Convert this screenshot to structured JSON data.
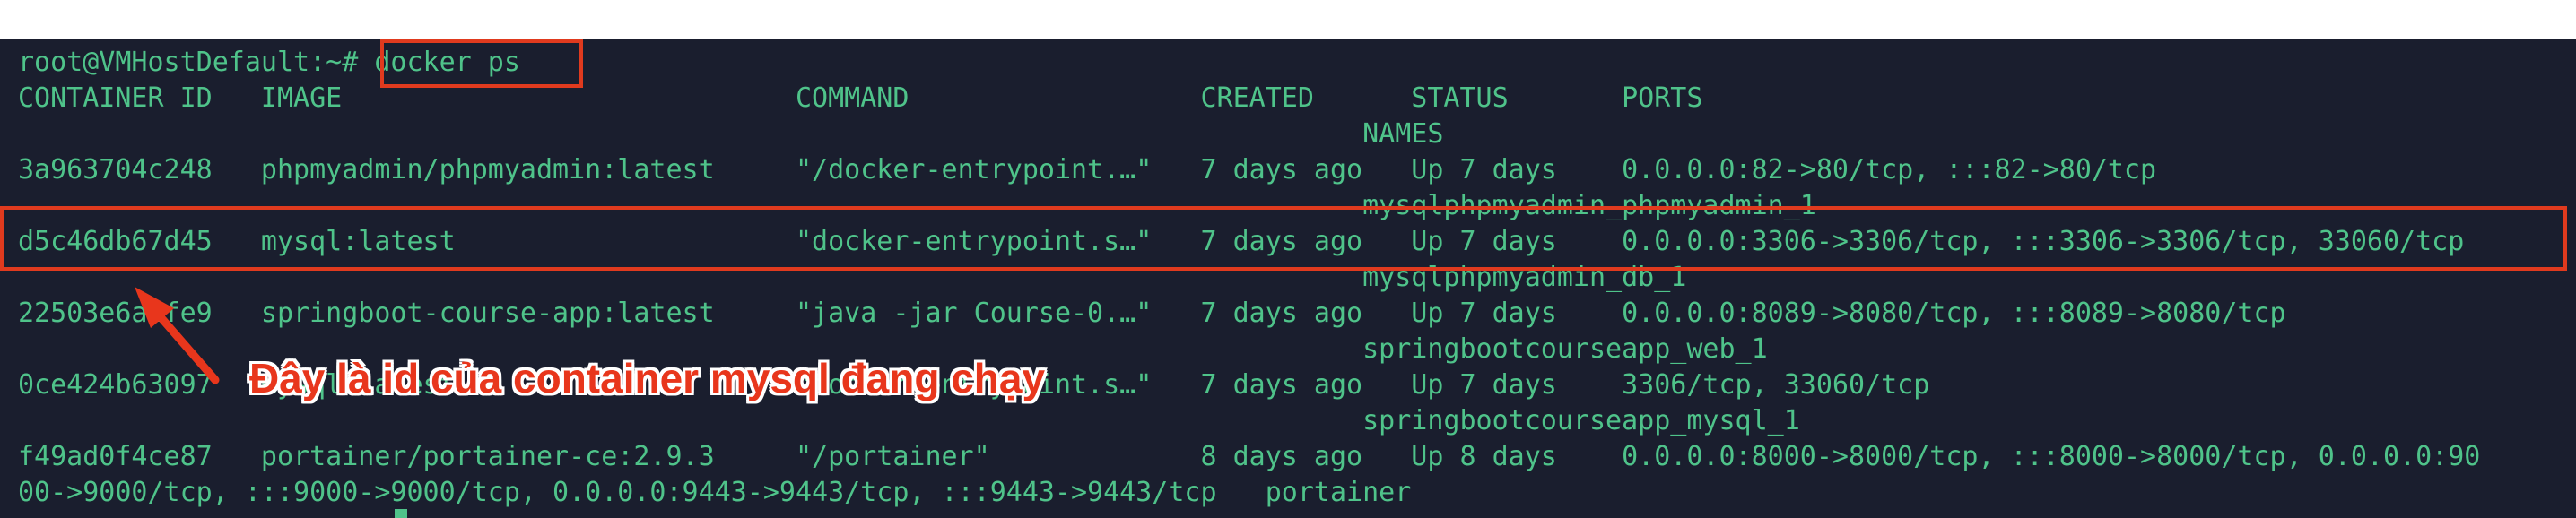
{
  "terminal": {
    "lines": [
      "root@VMHostDefault:~# docker ps",
      "CONTAINER ID   IMAGE                            COMMAND                  CREATED      STATUS       PORTS",
      "                                                                                   NAMES",
      "3a963704c248   phpmyadmin/phpmyadmin:latest     \"/docker-entrypoint.…\"   7 days ago   Up 7 days    0.0.0.0:82->80/tcp, :::82->80/tcp",
      "                                                                                   mysqlphpmyadmin_phpmyadmin_1",
      "d5c46db67d45   mysql:latest                     \"docker-entrypoint.s…\"   7 days ago   Up 7 days    0.0.0.0:3306->3306/tcp, :::3306->3306/tcp, 33060/tcp",
      "                                                                                   mysqlphpmyadmin_db_1",
      "22503e6a1fe9   springboot-course-app:latest     \"java -jar Course-0.…\"   7 days ago   Up 7 days    0.0.0.0:8089->8080/tcp, :::8089->8080/tcp",
      "                                                                                   springbootcourseapp_web_1",
      "0ce424b63097   mysql:latest                     \"docker-entrypoint.s…\"   7 days ago   Up 7 days    3306/tcp, 33060/tcp",
      "                                                                                   springbootcourseapp_mysql_1",
      "f49ad0f4ce87   portainer/portainer-ce:2.9.3     \"/portainer\"             8 days ago   Up 8 days    0.0.0.0:8000->8000/tcp, :::8000->8000/tcp, 0.0.0.0:90",
      "00->9000/tcp, :::9000->9000/tcp, 0.0.0.0:9443->9443/tcp, :::9443->9443/tcp   portainer"
    ]
  },
  "annotation": {
    "text": "Đây là id của container mysql đang chạy"
  },
  "colors": {
    "terminal_bg": "#1a1e2e",
    "terminal_text": "#4fc38a",
    "highlight": "#e03a1e"
  }
}
